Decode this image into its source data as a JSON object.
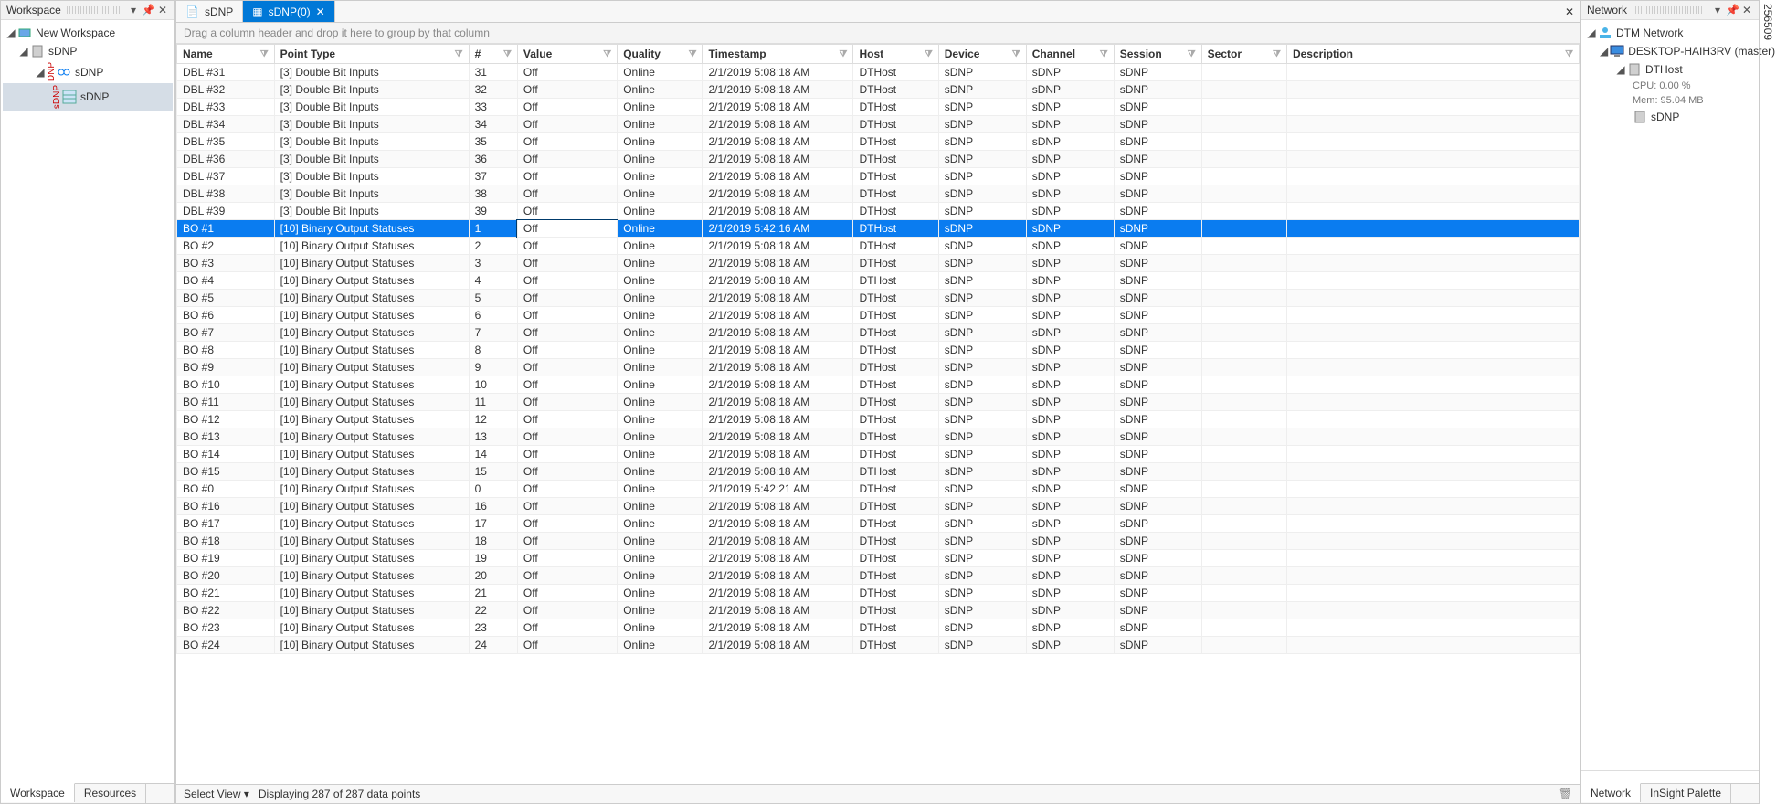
{
  "left": {
    "title": "Workspace",
    "tree": {
      "root": "New Workspace",
      "n1": "sDNP",
      "n2": "sDNP",
      "n3": "sDNP"
    },
    "dnp_prefix": "DNP",
    "sdnp_prefix": "sDNP",
    "tabs": {
      "workspace": "Workspace",
      "resources": "Resources"
    }
  },
  "center": {
    "tab1": "sDNP",
    "tab2": "sDNP(0)",
    "group_hint": "Drag a column header and drop it here to group by that column",
    "select_view": "Select View",
    "status": "Displaying 287 of 287 data points",
    "cols": {
      "name": "Name",
      "pointtype": "Point Type",
      "num": "#",
      "value": "Value",
      "quality": "Quality",
      "timestamp": "Timestamp",
      "host": "Host",
      "device": "Device",
      "channel": "Channel",
      "session": "Session",
      "sector": "Sector",
      "description": "Description"
    },
    "rows": [
      {
        "name": "DBL #31",
        "pt": "[3] Double Bit Inputs",
        "n": "31",
        "v": "Off",
        "q": "Online",
        "ts": "2/1/2019 5:08:18 AM",
        "h": "DTHost",
        "d": "sDNP",
        "c": "sDNP",
        "s": "sDNP"
      },
      {
        "name": "DBL #32",
        "pt": "[3] Double Bit Inputs",
        "n": "32",
        "v": "Off",
        "q": "Online",
        "ts": "2/1/2019 5:08:18 AM",
        "h": "DTHost",
        "d": "sDNP",
        "c": "sDNP",
        "s": "sDNP"
      },
      {
        "name": "DBL #33",
        "pt": "[3] Double Bit Inputs",
        "n": "33",
        "v": "Off",
        "q": "Online",
        "ts": "2/1/2019 5:08:18 AM",
        "h": "DTHost",
        "d": "sDNP",
        "c": "sDNP",
        "s": "sDNP"
      },
      {
        "name": "DBL #34",
        "pt": "[3] Double Bit Inputs",
        "n": "34",
        "v": "Off",
        "q": "Online",
        "ts": "2/1/2019 5:08:18 AM",
        "h": "DTHost",
        "d": "sDNP",
        "c": "sDNP",
        "s": "sDNP"
      },
      {
        "name": "DBL #35",
        "pt": "[3] Double Bit Inputs",
        "n": "35",
        "v": "Off",
        "q": "Online",
        "ts": "2/1/2019 5:08:18 AM",
        "h": "DTHost",
        "d": "sDNP",
        "c": "sDNP",
        "s": "sDNP"
      },
      {
        "name": "DBL #36",
        "pt": "[3] Double Bit Inputs",
        "n": "36",
        "v": "Off",
        "q": "Online",
        "ts": "2/1/2019 5:08:18 AM",
        "h": "DTHost",
        "d": "sDNP",
        "c": "sDNP",
        "s": "sDNP"
      },
      {
        "name": "DBL #37",
        "pt": "[3] Double Bit Inputs",
        "n": "37",
        "v": "Off",
        "q": "Online",
        "ts": "2/1/2019 5:08:18 AM",
        "h": "DTHost",
        "d": "sDNP",
        "c": "sDNP",
        "s": "sDNP"
      },
      {
        "name": "DBL #38",
        "pt": "[3] Double Bit Inputs",
        "n": "38",
        "v": "Off",
        "q": "Online",
        "ts": "2/1/2019 5:08:18 AM",
        "h": "DTHost",
        "d": "sDNP",
        "c": "sDNP",
        "s": "sDNP"
      },
      {
        "name": "DBL #39",
        "pt": "[3] Double Bit Inputs",
        "n": "39",
        "v": "Off",
        "q": "Online",
        "ts": "2/1/2019 5:08:18 AM",
        "h": "DTHost",
        "d": "sDNP",
        "c": "sDNP",
        "s": "sDNP"
      },
      {
        "name": "BO #1",
        "pt": "[10] Binary Output Statuses",
        "n": "1",
        "v": "Off",
        "q": "Online",
        "ts": "2/1/2019 5:42:16 AM",
        "h": "DTHost",
        "d": "sDNP",
        "c": "sDNP",
        "s": "sDNP",
        "sel": true
      },
      {
        "name": "BO #2",
        "pt": "[10] Binary Output Statuses",
        "n": "2",
        "v": "Off",
        "q": "Online",
        "ts": "2/1/2019 5:08:18 AM",
        "h": "DTHost",
        "d": "sDNP",
        "c": "sDNP",
        "s": "sDNP"
      },
      {
        "name": "BO #3",
        "pt": "[10] Binary Output Statuses",
        "n": "3",
        "v": "Off",
        "q": "Online",
        "ts": "2/1/2019 5:08:18 AM",
        "h": "DTHost",
        "d": "sDNP",
        "c": "sDNP",
        "s": "sDNP"
      },
      {
        "name": "BO #4",
        "pt": "[10] Binary Output Statuses",
        "n": "4",
        "v": "Off",
        "q": "Online",
        "ts": "2/1/2019 5:08:18 AM",
        "h": "DTHost",
        "d": "sDNP",
        "c": "sDNP",
        "s": "sDNP"
      },
      {
        "name": "BO #5",
        "pt": "[10] Binary Output Statuses",
        "n": "5",
        "v": "Off",
        "q": "Online",
        "ts": "2/1/2019 5:08:18 AM",
        "h": "DTHost",
        "d": "sDNP",
        "c": "sDNP",
        "s": "sDNP"
      },
      {
        "name": "BO #6",
        "pt": "[10] Binary Output Statuses",
        "n": "6",
        "v": "Off",
        "q": "Online",
        "ts": "2/1/2019 5:08:18 AM",
        "h": "DTHost",
        "d": "sDNP",
        "c": "sDNP",
        "s": "sDNP"
      },
      {
        "name": "BO #7",
        "pt": "[10] Binary Output Statuses",
        "n": "7",
        "v": "Off",
        "q": "Online",
        "ts": "2/1/2019 5:08:18 AM",
        "h": "DTHost",
        "d": "sDNP",
        "c": "sDNP",
        "s": "sDNP"
      },
      {
        "name": "BO #8",
        "pt": "[10] Binary Output Statuses",
        "n": "8",
        "v": "Off",
        "q": "Online",
        "ts": "2/1/2019 5:08:18 AM",
        "h": "DTHost",
        "d": "sDNP",
        "c": "sDNP",
        "s": "sDNP"
      },
      {
        "name": "BO #9",
        "pt": "[10] Binary Output Statuses",
        "n": "9",
        "v": "Off",
        "q": "Online",
        "ts": "2/1/2019 5:08:18 AM",
        "h": "DTHost",
        "d": "sDNP",
        "c": "sDNP",
        "s": "sDNP"
      },
      {
        "name": "BO #10",
        "pt": "[10] Binary Output Statuses",
        "n": "10",
        "v": "Off",
        "q": "Online",
        "ts": "2/1/2019 5:08:18 AM",
        "h": "DTHost",
        "d": "sDNP",
        "c": "sDNP",
        "s": "sDNP"
      },
      {
        "name": "BO #11",
        "pt": "[10] Binary Output Statuses",
        "n": "11",
        "v": "Off",
        "q": "Online",
        "ts": "2/1/2019 5:08:18 AM",
        "h": "DTHost",
        "d": "sDNP",
        "c": "sDNP",
        "s": "sDNP"
      },
      {
        "name": "BO #12",
        "pt": "[10] Binary Output Statuses",
        "n": "12",
        "v": "Off",
        "q": "Online",
        "ts": "2/1/2019 5:08:18 AM",
        "h": "DTHost",
        "d": "sDNP",
        "c": "sDNP",
        "s": "sDNP"
      },
      {
        "name": "BO #13",
        "pt": "[10] Binary Output Statuses",
        "n": "13",
        "v": "Off",
        "q": "Online",
        "ts": "2/1/2019 5:08:18 AM",
        "h": "DTHost",
        "d": "sDNP",
        "c": "sDNP",
        "s": "sDNP"
      },
      {
        "name": "BO #14",
        "pt": "[10] Binary Output Statuses",
        "n": "14",
        "v": "Off",
        "q": "Online",
        "ts": "2/1/2019 5:08:18 AM",
        "h": "DTHost",
        "d": "sDNP",
        "c": "sDNP",
        "s": "sDNP"
      },
      {
        "name": "BO #15",
        "pt": "[10] Binary Output Statuses",
        "n": "15",
        "v": "Off",
        "q": "Online",
        "ts": "2/1/2019 5:08:18 AM",
        "h": "DTHost",
        "d": "sDNP",
        "c": "sDNP",
        "s": "sDNP"
      },
      {
        "name": "BO #0",
        "pt": "[10] Binary Output Statuses",
        "n": "0",
        "v": "Off",
        "q": "Online",
        "ts": "2/1/2019 5:42:21 AM",
        "h": "DTHost",
        "d": "sDNP",
        "c": "sDNP",
        "s": "sDNP"
      },
      {
        "name": "BO #16",
        "pt": "[10] Binary Output Statuses",
        "n": "16",
        "v": "Off",
        "q": "Online",
        "ts": "2/1/2019 5:08:18 AM",
        "h": "DTHost",
        "d": "sDNP",
        "c": "sDNP",
        "s": "sDNP"
      },
      {
        "name": "BO #17",
        "pt": "[10] Binary Output Statuses",
        "n": "17",
        "v": "Off",
        "q": "Online",
        "ts": "2/1/2019 5:08:18 AM",
        "h": "DTHost",
        "d": "sDNP",
        "c": "sDNP",
        "s": "sDNP"
      },
      {
        "name": "BO #18",
        "pt": "[10] Binary Output Statuses",
        "n": "18",
        "v": "Off",
        "q": "Online",
        "ts": "2/1/2019 5:08:18 AM",
        "h": "DTHost",
        "d": "sDNP",
        "c": "sDNP",
        "s": "sDNP"
      },
      {
        "name": "BO #19",
        "pt": "[10] Binary Output Statuses",
        "n": "19",
        "v": "Off",
        "q": "Online",
        "ts": "2/1/2019 5:08:18 AM",
        "h": "DTHost",
        "d": "sDNP",
        "c": "sDNP",
        "s": "sDNP"
      },
      {
        "name": "BO #20",
        "pt": "[10] Binary Output Statuses",
        "n": "20",
        "v": "Off",
        "q": "Online",
        "ts": "2/1/2019 5:08:18 AM",
        "h": "DTHost",
        "d": "sDNP",
        "c": "sDNP",
        "s": "sDNP"
      },
      {
        "name": "BO #21",
        "pt": "[10] Binary Output Statuses",
        "n": "21",
        "v": "Off",
        "q": "Online",
        "ts": "2/1/2019 5:08:18 AM",
        "h": "DTHost",
        "d": "sDNP",
        "c": "sDNP",
        "s": "sDNP"
      },
      {
        "name": "BO #22",
        "pt": "[10] Binary Output Statuses",
        "n": "22",
        "v": "Off",
        "q": "Online",
        "ts": "2/1/2019 5:08:18 AM",
        "h": "DTHost",
        "d": "sDNP",
        "c": "sDNP",
        "s": "sDNP"
      },
      {
        "name": "BO #23",
        "pt": "[10] Binary Output Statuses",
        "n": "23",
        "v": "Off",
        "q": "Online",
        "ts": "2/1/2019 5:08:18 AM",
        "h": "DTHost",
        "d": "sDNP",
        "c": "sDNP",
        "s": "sDNP"
      },
      {
        "name": "BO #24",
        "pt": "[10] Binary Output Statuses",
        "n": "24",
        "v": "Off",
        "q": "Online",
        "ts": "2/1/2019 5:08:18 AM",
        "h": "DTHost",
        "d": "sDNP",
        "c": "sDNP",
        "s": "sDNP"
      }
    ]
  },
  "right": {
    "title": "Network",
    "root": "DTM Network",
    "desktop": "DESKTOP-HAIH3RV (master)",
    "host": "DTHost",
    "cpu": "CPU: 0.00 %",
    "mem": "Mem: 95.04 MB",
    "sdnp": "sDNP",
    "tabs": {
      "network": "Network",
      "insight": "InSight Palette"
    }
  },
  "sidecode": "256509"
}
